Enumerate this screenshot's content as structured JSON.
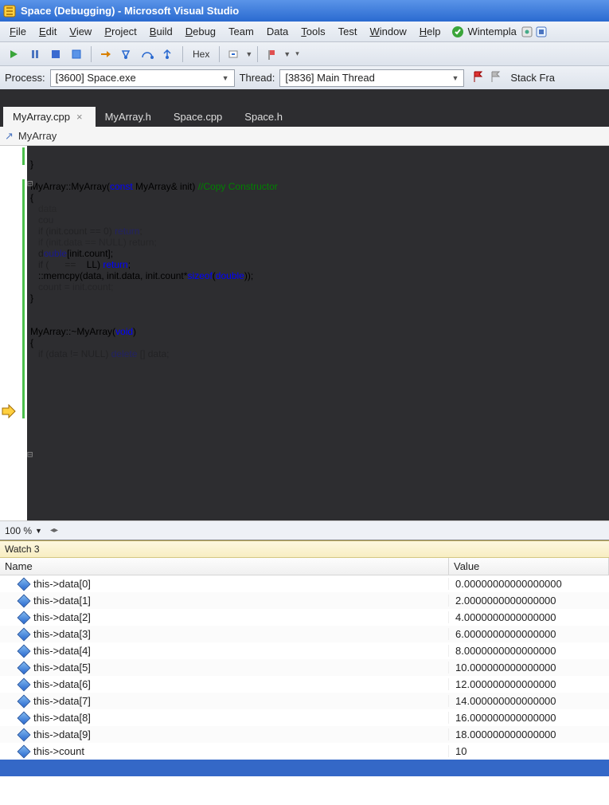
{
  "title": "Space (Debugging) - Microsoft Visual Studio",
  "menu": {
    "file": "File",
    "edit": "Edit",
    "view": "View",
    "project": "Project",
    "build": "Build",
    "debug": "Debug",
    "team": "Team",
    "data": "Data",
    "tools": "Tools",
    "test": "Test",
    "window": "Window",
    "help": "Help",
    "wintempla": "Wintempla"
  },
  "toolbar": {
    "hex": "Hex"
  },
  "process": {
    "process_label": "Process:",
    "process_value": "[3600] Space.exe",
    "thread_label": "Thread:",
    "thread_value": "[3836] Main Thread",
    "stack": "Stack Fra"
  },
  "tabs": [
    {
      "label": "MyArray.cpp",
      "close": "×",
      "active": true
    },
    {
      "label": "MyArray.h",
      "close": "",
      "active": false
    },
    {
      "label": "Space.cpp",
      "close": "",
      "active": false
    },
    {
      "label": "Space.h",
      "close": "",
      "active": false
    }
  ],
  "nav": {
    "scope": "MyArray"
  },
  "code": {
    "l1": "}",
    "l3a": "MyArray::MyArray(",
    "l3b": "const",
    "l3c": " MyArray& init)",
    "l3d": " //Copy Constructor",
    "l4": "{",
    "l5": "   data",
    "l6": "   cou",
    "l7a": "   if (init.count == 0) ",
    "l7b": "return",
    "l7c": ";",
    "l8": "   if (init.data == NULL) return;",
    "l9a": "   d",
    "l9b": "ouble",
    "l9c": "[init.count];",
    "l10a": "   if (      ==    ",
    "l10b": "LL) ",
    "l10c": "return",
    "l10d": ";",
    "l11a": "   ::memcpy(data, init.data, init.count*",
    "l11b": "sizeof",
    "l11c": "(",
    "l11d": "double",
    "l11e": "));",
    "l12": "   count = init.count;",
    "l13": "}",
    "l15a": "MyArray::~MyArray(",
    "l15b": "void",
    "l15c": ")",
    "l16": "{",
    "l17a": "   if (data != NULL) ",
    "l17b": "delete",
    "l17c": " [] data;"
  },
  "zoom": {
    "value": "100 %"
  },
  "watch": {
    "title": "Watch 3",
    "col_name": "Name",
    "col_value": "Value",
    "rows": [
      {
        "name": "this->data[0]",
        "value": "0.00000000000000000"
      },
      {
        "name": "this->data[1]",
        "value": "2.0000000000000000"
      },
      {
        "name": "this->data[2]",
        "value": "4.0000000000000000"
      },
      {
        "name": "this->data[3]",
        "value": "6.0000000000000000"
      },
      {
        "name": "this->data[4]",
        "value": "8.0000000000000000"
      },
      {
        "name": "this->data[5]",
        "value": "10.000000000000000"
      },
      {
        "name": "this->data[6]",
        "value": "12.000000000000000"
      },
      {
        "name": "this->data[7]",
        "value": "14.000000000000000"
      },
      {
        "name": "this->data[8]",
        "value": "16.000000000000000"
      },
      {
        "name": "this->data[9]",
        "value": "18.000000000000000"
      },
      {
        "name": "this->count",
        "value": "10"
      }
    ]
  }
}
